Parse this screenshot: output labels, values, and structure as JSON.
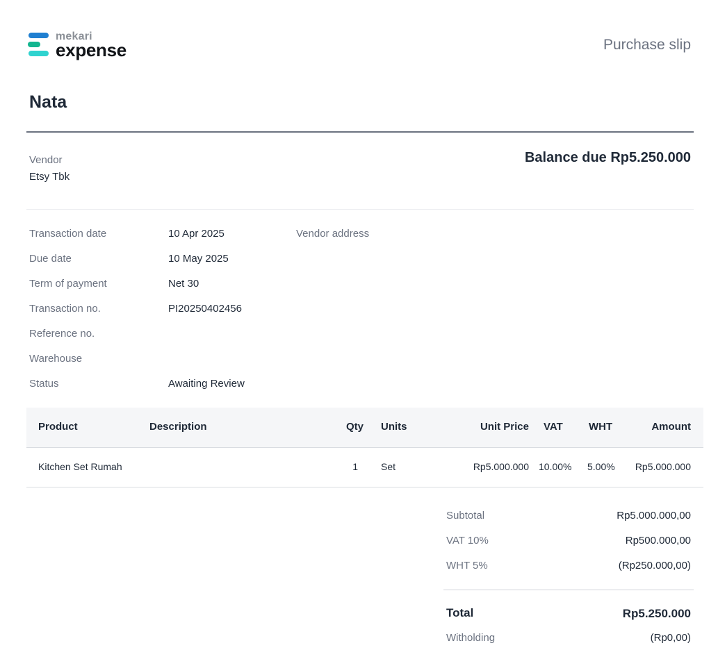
{
  "brand": {
    "name_small": "mekari",
    "name_big": "expense",
    "colors": {
      "bar_top": "#1f7fd1",
      "bar_mid": "#13b58f",
      "bar_bottom": "#2fd3cf"
    }
  },
  "header": {
    "document_type": "Purchase slip",
    "entity": "Nata"
  },
  "vendor": {
    "label": "Vendor",
    "name": "Etsy Tbk"
  },
  "balance_due": "Balance due Rp5.250.000",
  "details": [
    {
      "label": "Transaction date",
      "value": "10 Apr 2025"
    },
    {
      "label": "Due date",
      "value": "10 May 2025"
    },
    {
      "label": "Term of payment",
      "value": "Net 30"
    },
    {
      "label": "Transaction no.",
      "value": "PI20250402456"
    },
    {
      "label": "Reference no.",
      "value": ""
    },
    {
      "label": "Warehouse",
      "value": ""
    },
    {
      "label": "Status",
      "value": "Awaiting Review"
    }
  ],
  "vendor_address_label": "Vendor address",
  "table": {
    "headers": {
      "product": "Product",
      "description": "Description",
      "qty": "Qty",
      "units": "Units",
      "unit_price": "Unit Price",
      "vat": "VAT",
      "wht": "WHT",
      "amount": "Amount"
    },
    "rows": [
      {
        "product": "Kitchen Set Rumah",
        "description": "",
        "qty": "1",
        "units": "Set",
        "unit_price": "Rp5.000.000",
        "vat": "10.00%",
        "wht": "5.00%",
        "amount": "Rp5.000.000"
      }
    ]
  },
  "summary": {
    "subtotal_label": "Subtotal",
    "subtotal_value": "Rp5.000.000,00",
    "vat_label": "VAT 10%",
    "vat_value": "Rp500.000,00",
    "wht_label": "WHT 5%",
    "wht_value": "(Rp250.000,00)",
    "total_label": "Total",
    "total_value": "Rp5.250.000",
    "withholding_label": "Witholding",
    "withholding_value": "(Rp0,00)"
  }
}
